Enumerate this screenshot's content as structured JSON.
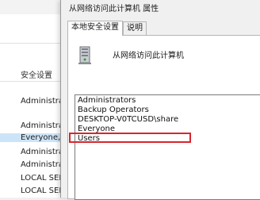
{
  "background_window": {
    "column_header": "安全设置",
    "rows": [
      {
        "text": "Administrators",
        "selected": false
      },
      {
        "text": "Administrators",
        "selected": false
      },
      {
        "text": "Everyone,Administrators",
        "selected": true
      },
      {
        "text": "Administrators",
        "selected": false
      },
      {
        "text": "Administrators",
        "selected": false
      },
      {
        "text": "LOCAL SERVICE",
        "selected": false
      },
      {
        "text": "LOCAL SERVICE",
        "selected": false
      }
    ]
  },
  "dialog": {
    "title": "从网络访问此计算机 属性",
    "tabs": [
      {
        "label": "本地安全设置",
        "active": true
      },
      {
        "label": "说明",
        "active": false
      }
    ],
    "policy_icon": "server-icon",
    "policy_name": "从网络访问此计算机",
    "members": [
      "Administrators",
      "Backup Operators",
      "DESKTOP-V0TCUSD\\share",
      "Everyone",
      "Users"
    ],
    "highlight_color": "#d9262c"
  }
}
